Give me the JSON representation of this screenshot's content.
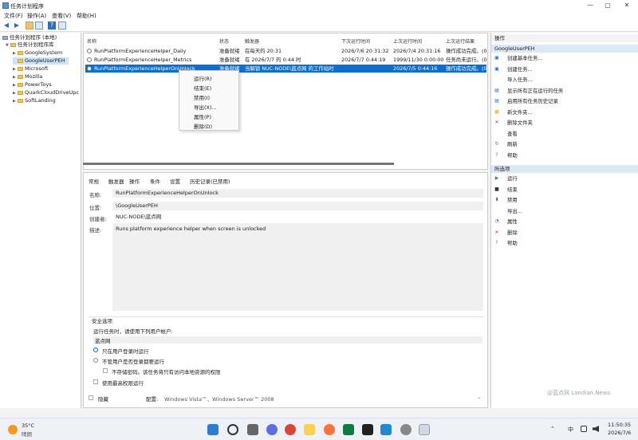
{
  "window": {
    "title": "任务计划程序",
    "controls": {
      "minimize": "—",
      "maximize": "▢",
      "close": "✕"
    }
  },
  "menu": [
    "文件(F)",
    "操作(A)",
    "查看(V)",
    "帮助(H)"
  ],
  "tree": {
    "root": "任务计划程序 (本地)",
    "library": "任务计划程序库",
    "folders": [
      "GoogleSystem",
      "GoogleUserPEH",
      "Microsoft",
      "Mozilla",
      "PowerToys",
      "QuarkCloudDriveUpc",
      "SoftLanding"
    ],
    "selected": "GoogleUserPEH"
  },
  "tasklist": {
    "headers": [
      "名称",
      "状态",
      "触发器",
      "下次运行时间",
      "上次运行时间",
      "上次运行结果"
    ],
    "rows": [
      {
        "name": "RunPlatformExperienceHelper_Daily",
        "status": "准备就绪",
        "trigger": "在每天的 20:31",
        "next": "2026/7/6 20:31:32",
        "last": "2026/7/4 20:31:16",
        "result": "操作成功完成。",
        "extra": "(0"
      },
      {
        "name": "RunPlatformExperienceHelper_Metrics",
        "status": "准备就绪",
        "trigger": "在 2026/7/7 的 0:44 时",
        "next": "2026/7/7 0:44:19",
        "last": "1999/11/30 0:00:00",
        "result": "任务尚未运行。",
        "extra": "(0"
      },
      {
        "name": "RunPlatformExperienceHelperOnUnlock",
        "status": "准备就绪",
        "trigger": "当解锁 NUC-NODE\\蓝点网 的工作站时",
        "next": "",
        "last": "2026/7/5 0:44:16",
        "result": "操作成功完成。",
        "extra": "(0"
      }
    ]
  },
  "context_menu": [
    "运行(R)",
    "结束(E)",
    "禁用(I)",
    "导出(X)...",
    "属性(P)",
    "删除(D)"
  ],
  "detail": {
    "tabs": [
      "常规",
      "触发器",
      "操作",
      "条件",
      "设置",
      "历史记录(已禁用)"
    ],
    "name_label": "名称:",
    "name_value": "RunPlatformExperienceHelperOnUnlock",
    "location_label": "位置:",
    "location_value": "\\GoogleUserPEH",
    "author_label": "创建者:",
    "author_value": "NUC-NODE\\蓝点网",
    "desc_label": "描述:",
    "desc_value": "Runs platform experience helper when screen is unlocked",
    "security": {
      "title": "安全选项",
      "run_as_label": "运行任务时，请使用下列用户帐户:",
      "run_as_user": "蓝点网",
      "opt_logged_on": "只在用户登录时运行",
      "opt_whether": "不管用户是否登录都要运行",
      "opt_no_password": "不存储密码。该任务将只有访问本地资源的权限",
      "opt_highest": "使用最高权限运行",
      "hidden_label": "隐藏",
      "config_label": "配置:",
      "config_value": "Windows Vista™、Windows Server™ 2008"
    }
  },
  "actions": {
    "header": "操作",
    "section1": "GoogleUserPEH",
    "items1": [
      {
        "icon": "create-basic-task-icon",
        "label": "创建基本任务..."
      },
      {
        "icon": "create-task-icon",
        "label": "创建任务..."
      },
      {
        "icon": "",
        "label": "导入任务..."
      },
      {
        "icon": "show-running-icon",
        "label": "显示所有正在运行的任务"
      },
      {
        "icon": "history-icon",
        "label": "启用所有任务历史记录"
      },
      {
        "icon": "new-folder-icon",
        "label": "新文件夹..."
      },
      {
        "icon": "delete-folder-icon",
        "label": "删除文件夹"
      },
      {
        "icon": "",
        "label": "查看"
      },
      {
        "icon": "refresh-icon",
        "label": "刷新"
      },
      {
        "icon": "help-icon",
        "label": "帮助"
      }
    ],
    "section2": "所选项",
    "items2": [
      {
        "icon": "run-icon",
        "label": "运行"
      },
      {
        "icon": "end-icon",
        "label": "结束"
      },
      {
        "icon": "disable-icon",
        "label": "禁用"
      },
      {
        "icon": "",
        "label": "导出..."
      },
      {
        "icon": "properties-icon",
        "label": "属性"
      },
      {
        "icon": "delete-icon",
        "label": "删除"
      },
      {
        "icon": "help-icon",
        "label": "帮助"
      }
    ]
  },
  "watermark": "@蓝点网 Landian.News",
  "taskbar": {
    "weather_temp": "35°C",
    "weather_text": "晴朗",
    "ime": "中",
    "time": "11:50:35",
    "date": "2026/7/6"
  },
  "colors": {
    "selection": "#0a6fd1",
    "accent": "#0067c0"
  }
}
